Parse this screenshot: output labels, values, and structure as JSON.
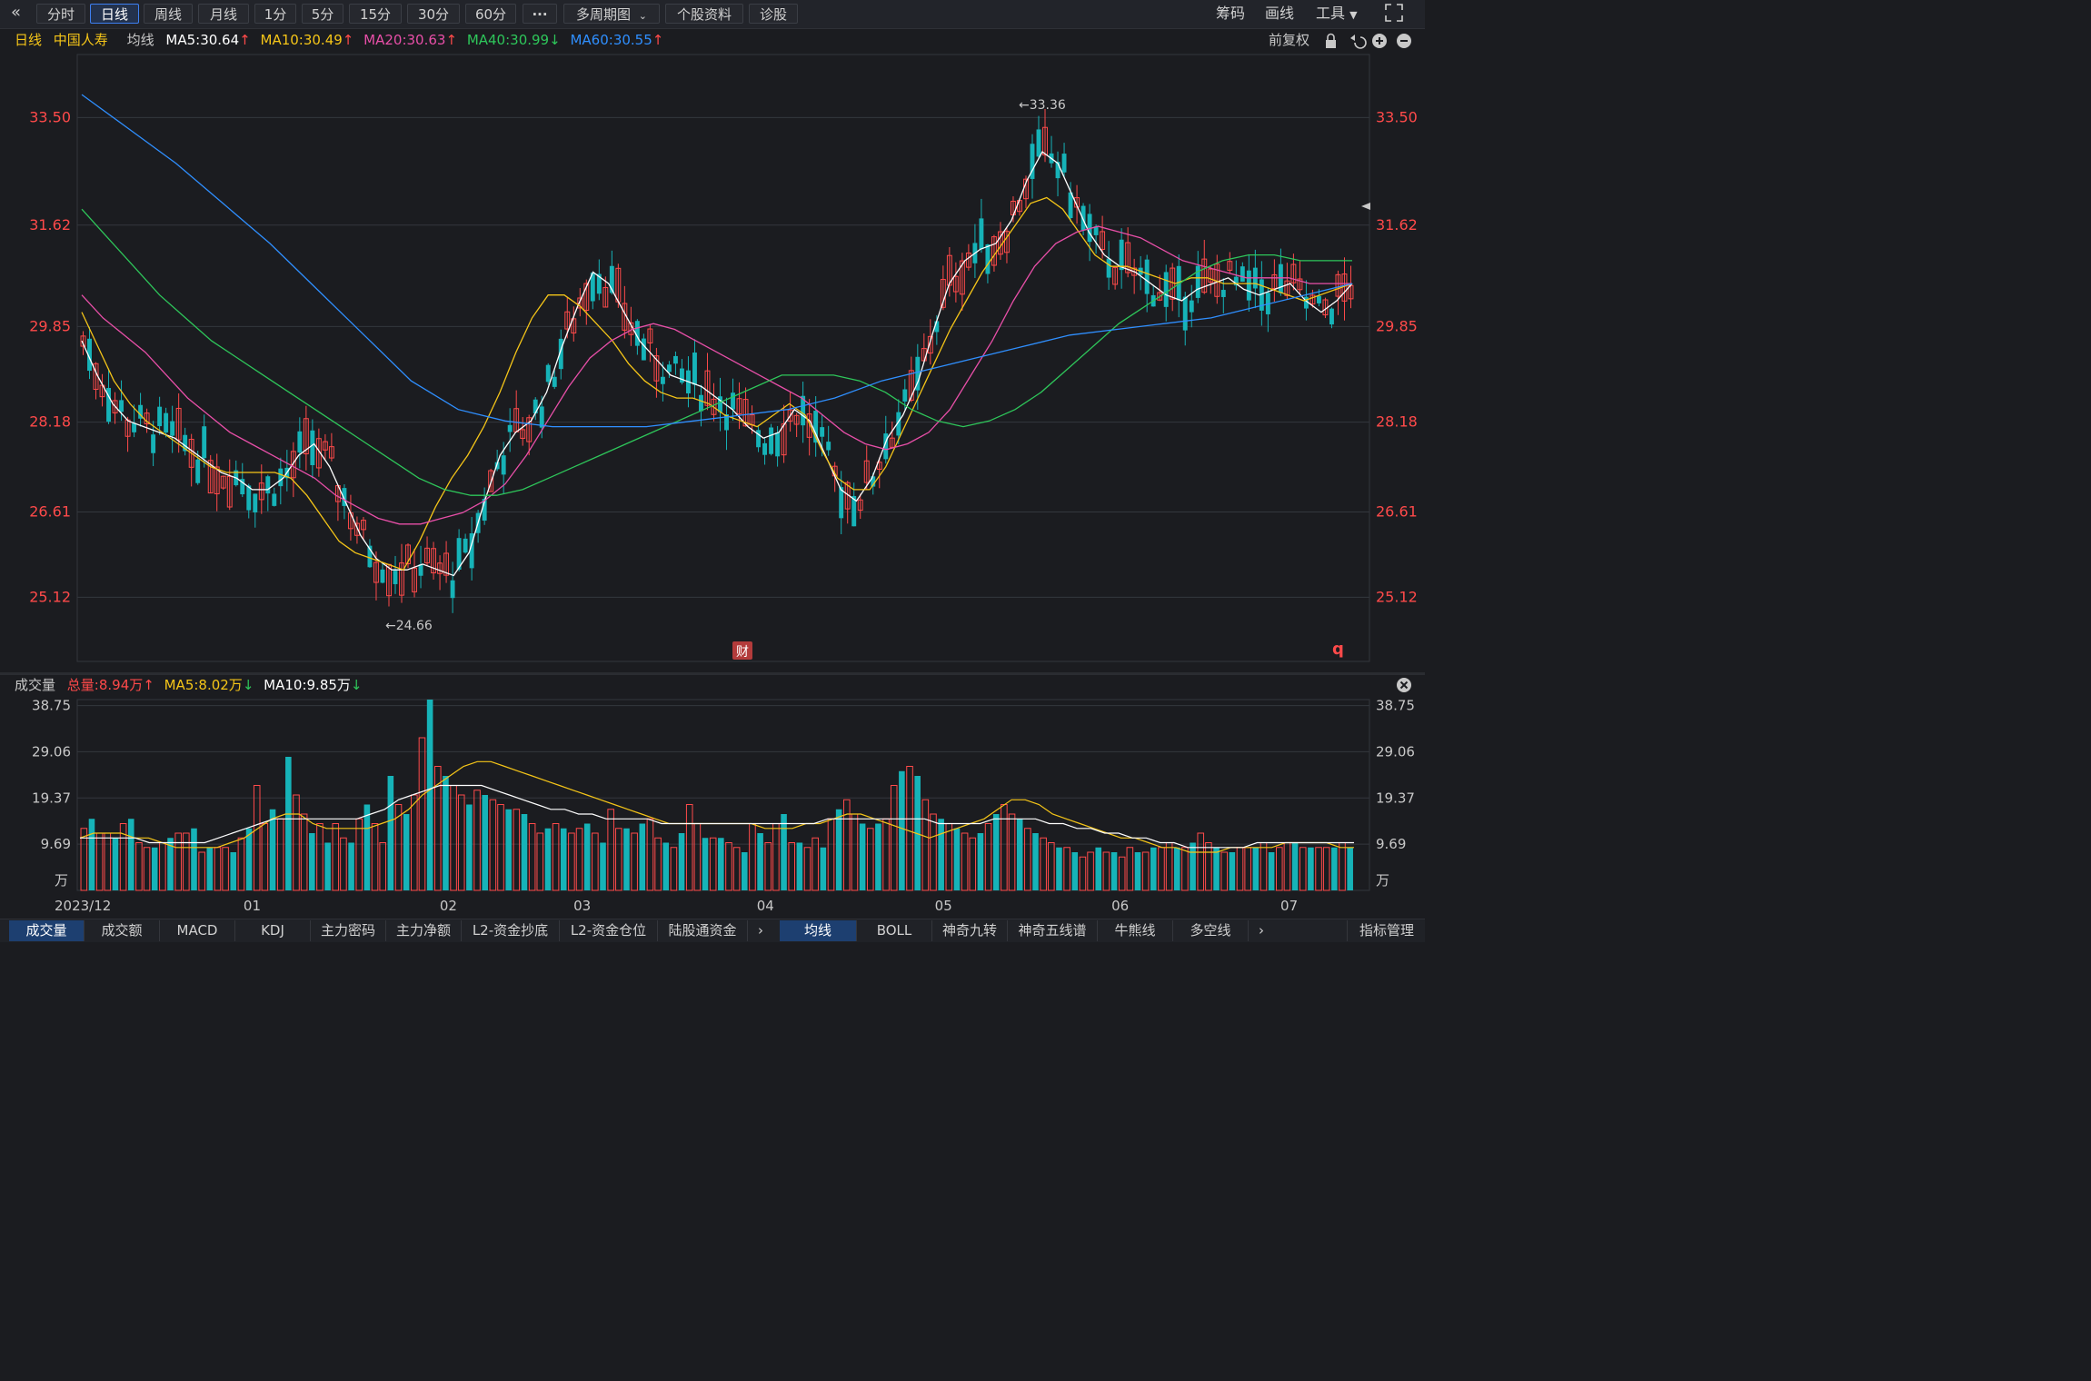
{
  "toolbar": {
    "back_icon": "double-chevron-left-icon",
    "periods": [
      "分时",
      "日线",
      "周线",
      "月线",
      "1分",
      "5分",
      "15分",
      "30分",
      "60分"
    ],
    "active_period": "日线",
    "more_label": "···",
    "multi_period": "多周期图",
    "stock_info": "个股资料",
    "diagnose": "诊股",
    "chips": "筹码",
    "draw": "画线",
    "tools": "工具",
    "fullscreen_icon": "expand-icon"
  },
  "price_legend": {
    "period": "日线",
    "name": "中国人寿",
    "ma_label": "均线",
    "ma5": "MA5:30.64",
    "ma10": "MA10:30.49",
    "ma20": "MA20:30.63",
    "ma40": "MA40:30.99",
    "ma60": "MA60:30.55",
    "adjust": "前复权",
    "colors": {
      "ma5": "#ffffff",
      "ma10": "#f5c518",
      "ma20": "#e84fa8",
      "ma40": "#2ec65a",
      "ma60": "#2f8fff",
      "up": "#ff4a4a",
      "down": "#16b3b8"
    }
  },
  "volume_legend": {
    "label": "成交量",
    "total": "总量:8.94万",
    "ma5": "MA5:8.02万",
    "ma10": "MA10:9.85万"
  },
  "chart_data": [
    {
      "type": "candlestick",
      "y_ticks": [
        "33.50",
        "31.62",
        "29.85",
        "28.18",
        "26.61",
        "25.12"
      ],
      "ylim": [
        24.0,
        34.6
      ],
      "x_ticks": [
        "2023/12",
        "01",
        "02",
        "03",
        "04",
        "05",
        "06",
        "07"
      ],
      "annotations": {
        "high": "←33.36",
        "low": "←24.66",
        "fin_mark": "财",
        "q_mark": "q"
      },
      "series": [
        {
          "name": "MA5",
          "color": "#ffffff",
          "values": [
            29.6,
            29.0,
            28.5,
            28.2,
            28.1,
            28.0,
            27.9,
            27.7,
            27.5,
            27.3,
            27.2,
            27.0,
            27.0,
            27.2,
            27.6,
            27.8,
            27.4,
            26.8,
            26.2,
            25.8,
            25.6,
            25.6,
            25.7,
            25.6,
            25.5,
            25.9,
            26.8,
            27.6,
            28.0,
            28.2,
            28.7,
            29.5,
            30.2,
            30.8,
            30.6,
            30.1,
            29.6,
            29.3,
            29.0,
            28.9,
            28.8,
            28.6,
            28.4,
            28.1,
            27.9,
            28.0,
            28.4,
            28.2,
            27.6,
            27.0,
            26.8,
            27.2,
            27.9,
            28.3,
            28.9,
            29.8,
            30.6,
            31.0,
            31.2,
            31.3,
            31.7,
            32.4,
            32.9,
            32.7,
            32.1,
            31.5,
            31.1,
            30.9,
            30.8,
            30.6,
            30.4,
            30.3,
            30.5,
            30.6,
            30.7,
            30.5,
            30.4,
            30.5,
            30.6,
            30.3,
            30.1,
            30.3,
            30.6
          ]
        },
        {
          "name": "MA10",
          "color": "#f5c518",
          "values": [
            30.1,
            29.5,
            28.9,
            28.5,
            28.2,
            28.0,
            27.8,
            27.6,
            27.4,
            27.3,
            27.3,
            27.3,
            27.3,
            27.2,
            26.9,
            26.5,
            26.1,
            25.9,
            25.8,
            25.7,
            25.6,
            26.1,
            26.7,
            27.2,
            27.6,
            28.1,
            28.7,
            29.4,
            30.0,
            30.4,
            30.4,
            30.2,
            29.9,
            29.6,
            29.2,
            28.9,
            28.7,
            28.6,
            28.6,
            28.5,
            28.3,
            28.2,
            28.1,
            28.3,
            28.5,
            28.3,
            27.7,
            27.2,
            27.0,
            27.0,
            27.4,
            28.0,
            28.6,
            29.2,
            29.8,
            30.3,
            30.8,
            31.2,
            31.6,
            32.0,
            32.1,
            31.9,
            31.5,
            31.1,
            30.9,
            30.9,
            30.8,
            30.7,
            30.6,
            30.7,
            30.7,
            30.6,
            30.6,
            30.6,
            30.5,
            30.4,
            30.3,
            30.4,
            30.5,
            30.6
          ]
        },
        {
          "name": "MA20",
          "color": "#e84fa8",
          "values": [
            30.4,
            30.0,
            29.7,
            29.4,
            29.0,
            28.6,
            28.3,
            28.0,
            27.8,
            27.6,
            27.4,
            27.2,
            26.9,
            26.7,
            26.5,
            26.4,
            26.4,
            26.5,
            26.6,
            26.8,
            27.1,
            27.6,
            28.2,
            28.8,
            29.3,
            29.6,
            29.8,
            29.9,
            29.8,
            29.6,
            29.4,
            29.2,
            29.0,
            28.8,
            28.6,
            28.3,
            28.0,
            27.8,
            27.7,
            27.8,
            28.0,
            28.4,
            29.0,
            29.6,
            30.3,
            30.9,
            31.3,
            31.5,
            31.6,
            31.5,
            31.4,
            31.2,
            31.0,
            30.9,
            30.8,
            30.7,
            30.7,
            30.7,
            30.6,
            30.6,
            30.6
          ]
        },
        {
          "name": "MA40",
          "color": "#2ec65a",
          "values": [
            31.9,
            31.4,
            30.9,
            30.4,
            30.0,
            29.6,
            29.3,
            29.0,
            28.7,
            28.4,
            28.1,
            27.8,
            27.5,
            27.2,
            27.0,
            26.9,
            26.9,
            27.0,
            27.2,
            27.4,
            27.6,
            27.8,
            28.0,
            28.2,
            28.4,
            28.6,
            28.8,
            29.0,
            29.0,
            29.0,
            28.9,
            28.7,
            28.4,
            28.2,
            28.1,
            28.2,
            28.4,
            28.7,
            29.1,
            29.5,
            29.9,
            30.2,
            30.5,
            30.8,
            31.0,
            31.1,
            31.1,
            31.0,
            31.0,
            31.0
          ]
        },
        {
          "name": "MA60",
          "color": "#2f8fff",
          "values": [
            33.9,
            33.3,
            32.7,
            32.0,
            31.3,
            30.5,
            29.7,
            28.9,
            28.4,
            28.2,
            28.1,
            28.1,
            28.1,
            28.2,
            28.3,
            28.4,
            28.6,
            28.9,
            29.1,
            29.3,
            29.5,
            29.7,
            29.8,
            29.9,
            30.0,
            30.2,
            30.4,
            30.6
          ]
        }
      ]
    },
    {
      "type": "bar",
      "y_ticks": [
        "38.75",
        "29.06",
        "19.37",
        "9.69"
      ],
      "unit": "万",
      "ylim": [
        0,
        40
      ],
      "values": [
        13,
        15,
        12,
        12,
        11,
        14,
        15,
        10,
        9,
        9,
        10,
        11,
        12,
        12,
        13,
        8,
        9,
        9,
        9,
        8,
        11,
        13,
        22,
        14,
        17,
        15,
        28,
        20,
        16,
        12,
        14,
        10,
        14,
        11,
        10,
        15,
        18,
        14,
        10,
        24,
        18,
        16,
        20,
        32,
        40,
        26,
        24,
        22,
        20,
        18,
        21,
        20,
        19,
        18,
        17,
        17,
        16,
        14,
        12,
        13,
        14,
        13,
        12,
        13,
        14,
        12,
        10,
        17,
        13,
        13,
        12,
        14,
        15,
        11,
        10,
        9,
        12,
        18,
        14,
        11,
        11,
        11,
        10,
        9,
        8,
        14,
        12,
        10,
        14,
        16,
        10,
        10,
        9,
        11,
        9,
        15,
        17,
        19,
        16,
        14,
        13,
        14,
        15,
        22,
        25,
        26,
        24,
        19,
        16,
        15,
        14,
        13,
        12,
        11,
        12,
        14,
        16,
        18,
        16,
        15,
        13,
        12,
        11,
        10,
        9,
        9,
        8,
        7,
        8,
        9,
        8,
        8,
        7,
        9,
        8,
        8,
        9,
        9,
        10,
        9,
        9,
        10,
        12,
        10,
        9,
        8,
        8,
        9,
        9,
        9,
        10,
        8,
        9,
        10,
        10,
        9,
        9,
        9,
        9,
        9,
        10,
        9
      ],
      "ma5": [
        11,
        12,
        12,
        12,
        11,
        11,
        10,
        9,
        9,
        9,
        9,
        10,
        11,
        13,
        15,
        16,
        16,
        14,
        13,
        13,
        13,
        13,
        14,
        15,
        17,
        20,
        22,
        24,
        26,
        27,
        27,
        26,
        25,
        24,
        23,
        22,
        21,
        20,
        19,
        18,
        17,
        16,
        15,
        14,
        14,
        14,
        14,
        14,
        14,
        14,
        13,
        13,
        13,
        14,
        14,
        15,
        16,
        16,
        15,
        14,
        13,
        12,
        11,
        12,
        13,
        14,
        15,
        17,
        19,
        19,
        18,
        16,
        15,
        14,
        13,
        12,
        11,
        11,
        10,
        9,
        9,
        8,
        8,
        8,
        9,
        9,
        9,
        9,
        10,
        10,
        10,
        10,
        9,
        9
      ],
      "ma10": [
        11,
        11,
        11,
        11,
        11,
        10,
        10,
        10,
        10,
        10,
        11,
        12,
        13,
        14,
        15,
        15,
        15,
        15,
        15,
        15,
        15,
        16,
        17,
        19,
        20,
        21,
        22,
        22,
        22,
        22,
        21,
        20,
        19,
        18,
        17,
        17,
        16,
        16,
        15,
        15,
        15,
        15,
        14,
        14,
        14,
        14,
        14,
        14,
        14,
        14,
        14,
        14,
        14,
        14,
        15,
        15,
        15,
        15,
        15,
        15,
        15,
        15,
        14,
        14,
        14,
        14,
        15,
        15,
        15,
        15,
        14,
        14,
        13,
        13,
        12,
        12,
        11,
        11,
        10,
        10,
        9,
        9,
        9,
        9,
        9,
        10,
        10,
        10,
        10,
        10,
        10,
        10,
        10
      ]
    }
  ],
  "tabs": {
    "left": [
      "成交量",
      "成交额",
      "MACD",
      "KDJ",
      "主力密码",
      "主力净额",
      "L2-资金抄底",
      "L2-资金仓位",
      "陆股通资金"
    ],
    "right": [
      "均线",
      "BOLL",
      "神奇九转",
      "神奇五线谱",
      "牛熊线",
      "多空线"
    ],
    "manage": "指标管理"
  }
}
